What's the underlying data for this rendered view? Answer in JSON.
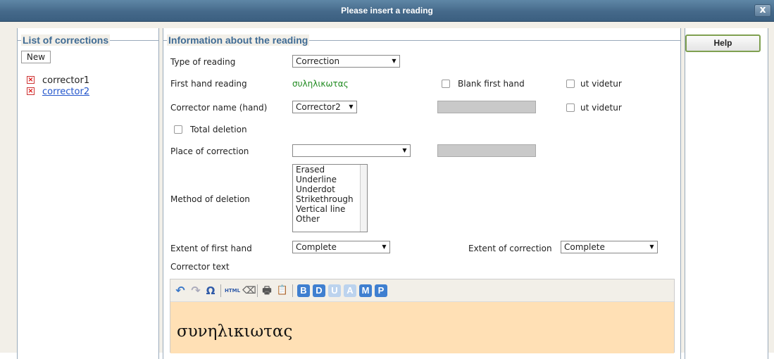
{
  "window": {
    "title": "Please insert a reading",
    "close_label": "x"
  },
  "left": {
    "legend": "List of corrections",
    "new_label": "New",
    "items": [
      {
        "label": "corrector1",
        "delete_glyph": "☒"
      },
      {
        "label": "corrector2",
        "delete_glyph": "☒"
      }
    ]
  },
  "main": {
    "legend": "Information about the reading",
    "type_label": "Type of reading",
    "type_value": "Correction",
    "first_hand_label": "First hand reading",
    "first_hand_value": "συληλικωτας",
    "blank_first_hand_label": "Blank first hand",
    "ut_videtur_label": "ut videtur",
    "corrector_name_label": "Corrector name (hand)",
    "corrector_name_value": "Corrector2",
    "ut_videtur2_label": "ut videtur",
    "total_deletion_label": "Total deletion",
    "place_label": "Place of correction",
    "place_value": "",
    "method_label": "Method of deletion",
    "method_options": [
      "Erased",
      "Underline",
      "Underdot",
      "Strikethrough",
      "Vertical line",
      "Other"
    ],
    "extent_first_label": "Extent of first hand",
    "extent_first_value": "Complete",
    "extent_corr_label": "Extent of correction",
    "extent_corr_value": "Complete",
    "corrector_text_label": "Corrector text",
    "toolbar": {
      "undo": "↶",
      "redo": "↷",
      "special_char": "Ω",
      "html": "HTML",
      "eraser": "⌫",
      "print": "🖶",
      "paste": "📋",
      "btn_b": "B",
      "btn_d": "D",
      "btn_u": "U",
      "btn_a": "A",
      "btn_m": "M",
      "btn_p": "P"
    },
    "editor_text": "συνηλικιωτας"
  },
  "help_label": "Help",
  "colors": {
    "titlebar": "#45698a",
    "legend": "#3f6b94",
    "green_text": "#1f8a1f",
    "link": "#2255cc",
    "editor_bg": "#ffe0b5",
    "blue_btn": "#3f7fd0",
    "faded_btn": "#bcd3ee",
    "help_border": "#7fa050"
  }
}
